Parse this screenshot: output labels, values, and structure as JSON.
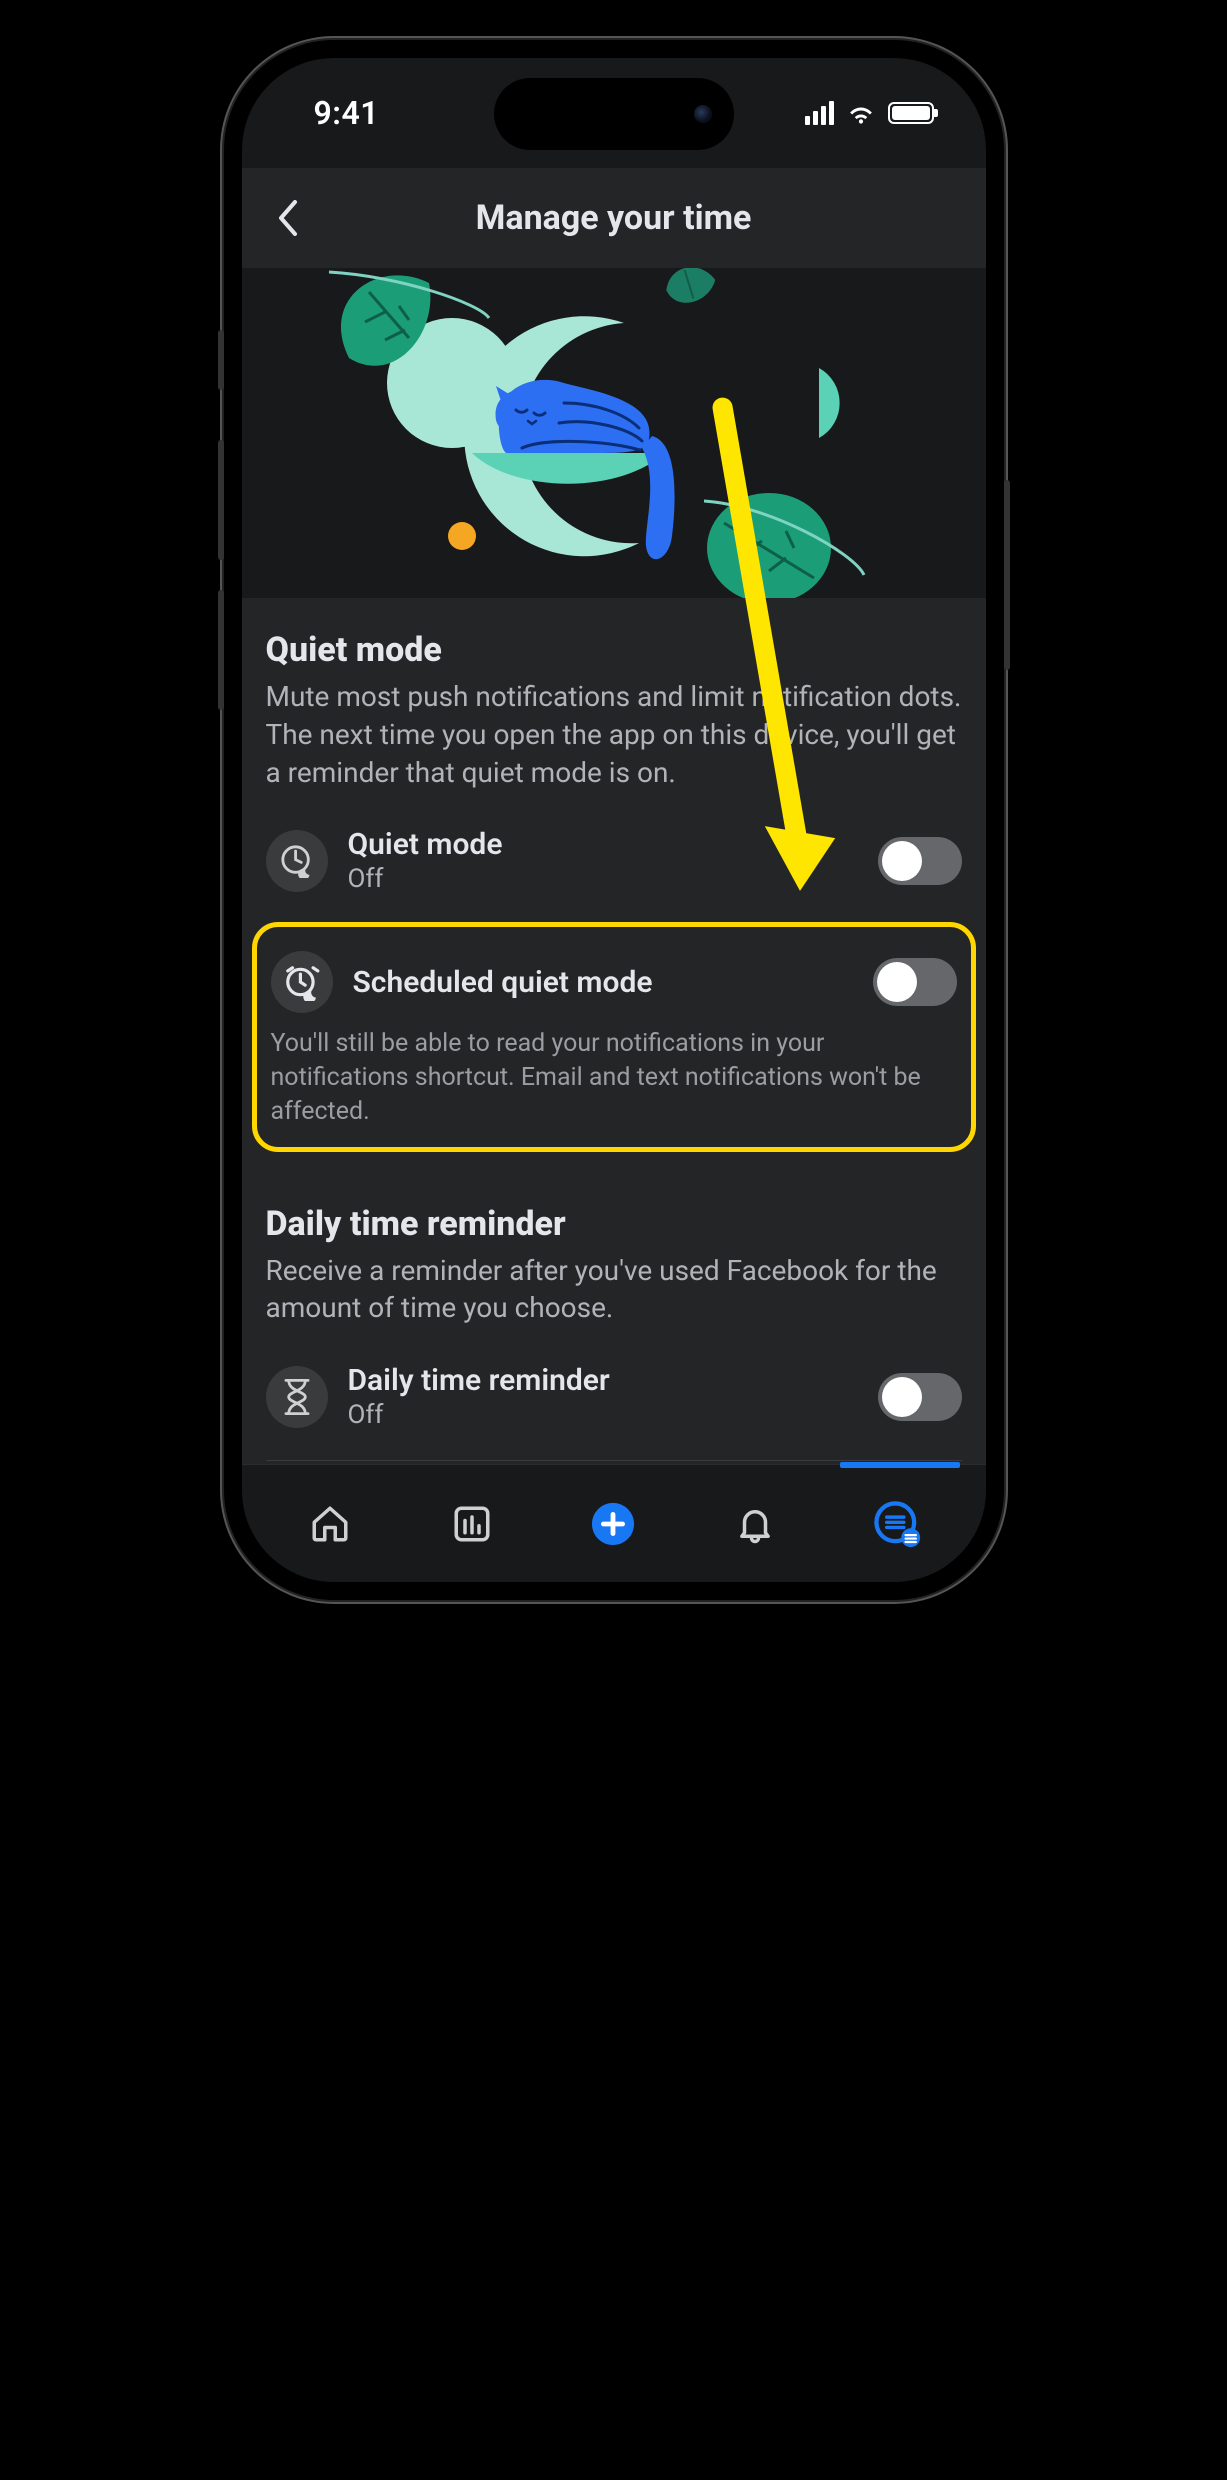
{
  "status": {
    "time": "9:41"
  },
  "header": {
    "title": "Manage your time"
  },
  "quietMode": {
    "title": "Quiet mode",
    "description": "Mute most push notifications and limit notification dots. The next time you open the app on this device, you'll get a reminder that quiet mode is on.",
    "toggleLabel": "Quiet mode",
    "toggleStatus": "Off"
  },
  "scheduled": {
    "label": "Scheduled quiet mode",
    "note": "You'll still be able to read your notifications in your notifications shortcut. Email and text notifications won't be affected."
  },
  "daily": {
    "title": "Daily time reminder",
    "description": "Receive a reminder after you've used Facebook for the amount of time you choose.",
    "toggleLabel": "Daily time reminder",
    "toggleStatus": "Off"
  }
}
